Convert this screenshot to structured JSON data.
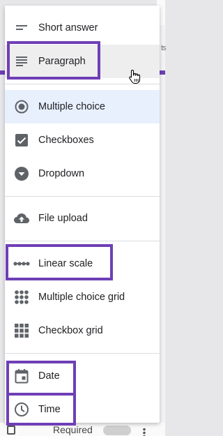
{
  "background": {
    "right_edge_text": "ts",
    "bottom_text": "Required"
  },
  "menu": {
    "items": [
      {
        "label": "Short answer",
        "icon": "short-answer-icon"
      },
      {
        "label": "Paragraph",
        "icon": "paragraph-icon",
        "state": "hover"
      },
      {
        "label": "Multiple choice",
        "icon": "radio-button-icon",
        "state": "selected"
      },
      {
        "label": "Checkboxes",
        "icon": "checkbox-icon"
      },
      {
        "label": "Dropdown",
        "icon": "dropdown-icon"
      },
      {
        "label": "File upload",
        "icon": "cloud-upload-icon"
      },
      {
        "label": "Linear scale",
        "icon": "linear-scale-icon"
      },
      {
        "label": "Multiple choice grid",
        "icon": "grid-dots-icon"
      },
      {
        "label": "Checkbox grid",
        "icon": "grid-squares-icon"
      },
      {
        "label": "Date",
        "icon": "calendar-icon"
      },
      {
        "label": "Time",
        "icon": "clock-icon"
      }
    ],
    "highlighted_items": [
      "Paragraph",
      "Linear scale",
      "Date",
      "Time"
    ]
  },
  "colors": {
    "highlight": "#6f3fb6",
    "selected_bg": "#e8f0fe",
    "hover_bg": "#eeeeee",
    "icon": "#5f6368",
    "text": "#202124"
  }
}
